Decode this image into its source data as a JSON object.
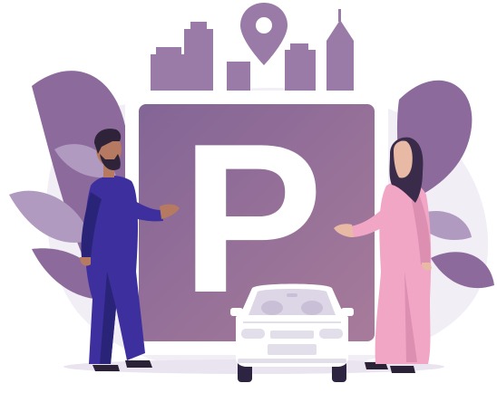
{
  "illustration": {
    "sign": {
      "letter": "P"
    },
    "icons": {
      "location_pin": "map-pin-icon",
      "parking_sign": "parking-sign-icon",
      "car": "car-icon"
    },
    "colors": {
      "background_blob": "#f1eef6",
      "foliage": "#8d6a9c",
      "foliage_light": "#b19ac0",
      "city": "#9a7aa6",
      "sign_panel_start": "#836596",
      "sign_panel_end": "#a77b9a",
      "sign_border": "#ffffff",
      "car_body": "#ffffff",
      "car_trim": "#e2deea",
      "car_window": "#ddd6e6",
      "car_tire": "#2c2440",
      "man_robe": "#3d2f9d",
      "man_robe_shadow": "#2a2478",
      "man_skin": "#b57a61",
      "man_hair": "#2e2338",
      "woman_dress": "#f1a6c6",
      "woman_dress_shadow": "#dd8fb1",
      "woman_hijab": "#3a2b4a",
      "woman_skin": "#e8b9a5",
      "shoes": "#2b2238"
    }
  }
}
